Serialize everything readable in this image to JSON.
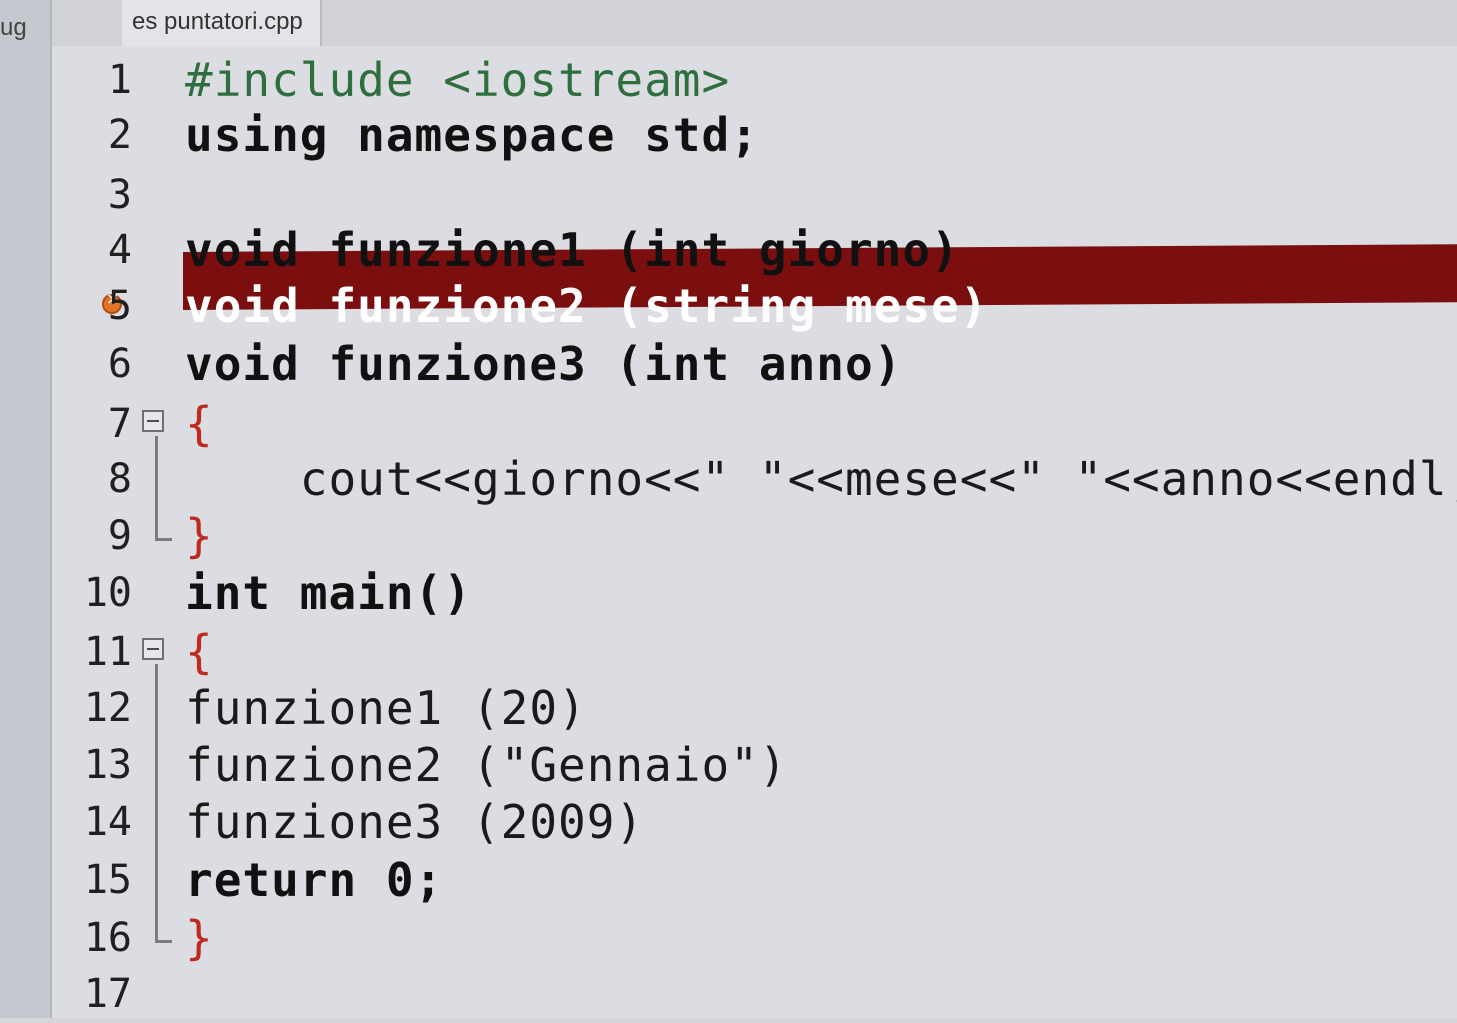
{
  "left_panel_tab": "ug",
  "file_tab": "es puntatori.cpp",
  "colors": {
    "highlight_line": "#7b0f0f",
    "keyword": "#111111",
    "symbol": "#c0291f",
    "string": "#1b37b8",
    "number": "#7a3fa0",
    "preprocessor": "#2f6e3e"
  },
  "lines": [
    {
      "n": "1",
      "text": "#include <iostream>"
    },
    {
      "n": "2",
      "text": "using namespace std;"
    },
    {
      "n": "3",
      "text": ""
    },
    {
      "n": "4",
      "text": "void funzione1 (int giorno)"
    },
    {
      "n": "5",
      "text": "void funzione2 (string mese)",
      "highlighted": true,
      "breakpoint": true
    },
    {
      "n": "6",
      "text": "void funzione3 (int anno)"
    },
    {
      "n": "7",
      "text": "{",
      "fold": "open"
    },
    {
      "n": "8",
      "text": "    cout<<giorno<<\" \"<<mese<<\" \"<<anno<<endl;"
    },
    {
      "n": "9",
      "text": "}",
      "fold": "end"
    },
    {
      "n": "10",
      "text": "int main()"
    },
    {
      "n": "11",
      "text": "{",
      "fold": "open"
    },
    {
      "n": "12",
      "text": "funzione1 (20)"
    },
    {
      "n": "13",
      "text": "funzione2 (\"Gennaio\")"
    },
    {
      "n": "14",
      "text": "funzione3 (2009)"
    },
    {
      "n": "15",
      "text": "return 0;"
    },
    {
      "n": "16",
      "text": "}",
      "fold": "end"
    },
    {
      "n": "17",
      "text": ""
    }
  ]
}
